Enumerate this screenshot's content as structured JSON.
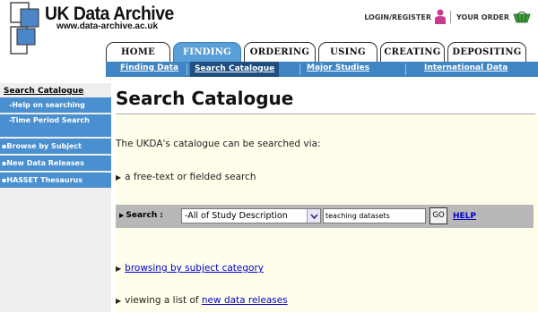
{
  "header": {
    "logo_title": "UK Data Archive",
    "logo_url": "www.data-archive.ac.uk",
    "login_register": "LOGIN/REGISTER",
    "your_order": "YOUR ORDER"
  },
  "tabs": [
    "HOME",
    "FINDING",
    "ORDERING",
    "USING",
    "CREATING",
    "DEPOSITING"
  ],
  "active_tab": "FINDING",
  "subnav": [
    "Finding Data",
    "Search Catalogue",
    "Major Studies",
    "International Data"
  ],
  "active_subnav": "Search Catalogue",
  "sidebar": {
    "heading": "Search Catalogue",
    "items": [
      "-Help on searching",
      "-Time Period Search",
      "▪Browse by Subject",
      "▪New Data Releases",
      "▪HASSET Thesaurus"
    ]
  },
  "main": {
    "title": "Search Catalogue",
    "intro": "The UKDA's catalogue can be searched via:",
    "bullet_freetext": "a free-text or fielded search",
    "search": {
      "label": "Search :",
      "field_selected": "-All of Study Description",
      "query_value": "teaching datasets",
      "go_label": "GO",
      "help_label": "HELP"
    },
    "bullet_browse_link": "browsing by subject category",
    "bullet_new_prefix": "viewing a list of",
    "bullet_new_link": "new data releases"
  },
  "colors": {
    "tab_active": "#5aa0d8",
    "subnav_bar": "#3f85c4",
    "subnav_active": "#1e4f80",
    "sidebar_item": "#4a8fcf",
    "content_bg": "#fefeea",
    "search_bar": "#b8b8b8",
    "link": "#0000cc"
  }
}
